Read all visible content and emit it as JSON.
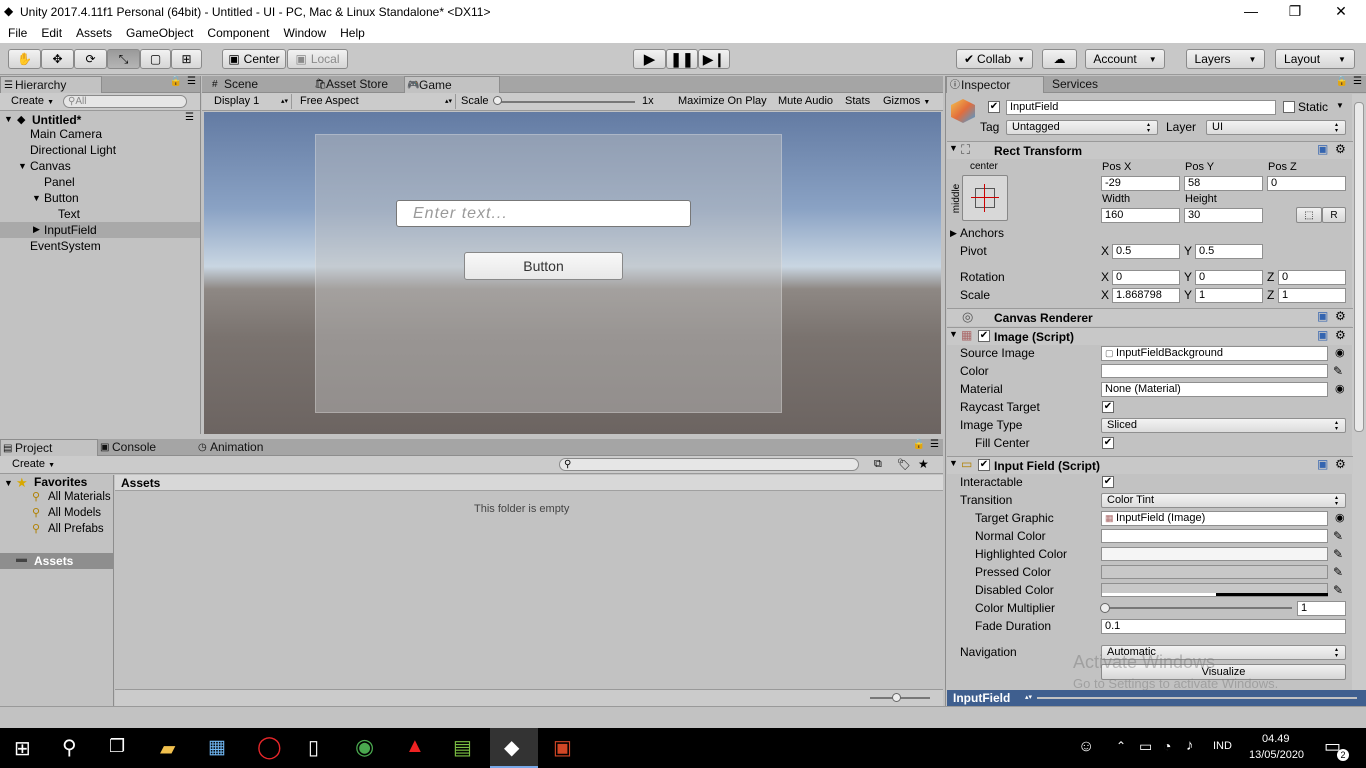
{
  "window": {
    "title": "Unity 2017.4.11f1 Personal (64bit) - Untitled - UI - PC, Mac & Linux Standalone* <DX11>",
    "minimize": "—",
    "restore": "❐",
    "close": "✕"
  },
  "menu": [
    "File",
    "Edit",
    "Assets",
    "GameObject",
    "Component",
    "Window",
    "Help"
  ],
  "toolbar": {
    "center": "Center",
    "local": "Local",
    "collab": "Collab",
    "account": "Account",
    "layers": "Layers",
    "layout": "Layout"
  },
  "hierarchy": {
    "tab": "Hierarchy",
    "create": "Create",
    "search_placeholder": "All",
    "scene": "Untitled*",
    "items": [
      "Main Camera",
      "Directional Light",
      "Canvas",
      "Panel",
      "Button",
      "Text",
      "InputField",
      "EventSystem"
    ]
  },
  "scene_tabs": {
    "scene": "Scene",
    "store": "Asset Store",
    "game": "Game"
  },
  "game_bar": {
    "display": "Display 1",
    "aspect": "Free Aspect",
    "scale_label": "Scale",
    "scale_value": "1x",
    "maximize": "Maximize On Play",
    "mute": "Mute Audio",
    "stats": "Stats",
    "gizmos": "Gizmos"
  },
  "game_view": {
    "placeholder": "Enter text...",
    "button": "Button"
  },
  "project": {
    "tab": "Project",
    "console": "Console",
    "animation": "Animation",
    "create": "Create",
    "favorites": "Favorites",
    "fav_items": [
      "All Materials",
      "All Models",
      "All Prefabs"
    ],
    "assets": "Assets",
    "assets_header": "Assets",
    "empty": "This folder is empty"
  },
  "inspector": {
    "tab": "Inspector",
    "services": "Services",
    "name": "InputField",
    "static": "Static",
    "tag_label": "Tag",
    "tag": "Untagged",
    "layer_label": "Layer",
    "layer": "UI",
    "rect": {
      "title": "Rect Transform",
      "anchor_h": "center",
      "anchor_v": "middle",
      "posx_l": "Pos X",
      "posy_l": "Pos Y",
      "posz_l": "Pos Z",
      "posx": "-29",
      "posy": "58",
      "posz": "0",
      "w_l": "Width",
      "h_l": "Height",
      "w": "160",
      "h": "30",
      "r": "R",
      "anchors": "Anchors",
      "pivot": "Pivot",
      "pivx": "0.5",
      "pivy": "0.5",
      "rotation": "Rotation",
      "rotx": "0",
      "roty": "0",
      "rotz": "0",
      "scale": "Scale",
      "sx": "1.868798",
      "sy": "1",
      "sz": "1",
      "X": "X",
      "Y": "Y",
      "Z": "Z"
    },
    "canvas_renderer": "Canvas Renderer",
    "image": {
      "title": "Image (Script)",
      "source_l": "Source Image",
      "source": "InputFieldBackground",
      "color_l": "Color",
      "material_l": "Material",
      "material": "None (Material)",
      "raycast_l": "Raycast Target",
      "type_l": "Image Type",
      "type": "Sliced",
      "fill_l": "Fill Center"
    },
    "input": {
      "title": "Input Field (Script)",
      "interactable_l": "Interactable",
      "transition_l": "Transition",
      "transition": "Color Tint",
      "target_l": "Target Graphic",
      "target": "InputField (Image)",
      "normal_l": "Normal Color",
      "highlight_l": "Highlighted Color",
      "pressed_l": "Pressed Color",
      "disabled_l": "Disabled Color",
      "mult_l": "Color Multiplier",
      "mult": "1",
      "fade_l": "Fade Duration",
      "fade": "0.1",
      "nav_l": "Navigation",
      "nav": "Automatic",
      "visualize": "Visualize"
    },
    "footer": "InputField"
  },
  "watermark": {
    "line1": "Activate Windows",
    "line2": "Go to Settings to activate Windows."
  },
  "taskbar": {
    "lang": "IND",
    "time": "04.49",
    "date": "13/05/2020",
    "notif": "2"
  }
}
